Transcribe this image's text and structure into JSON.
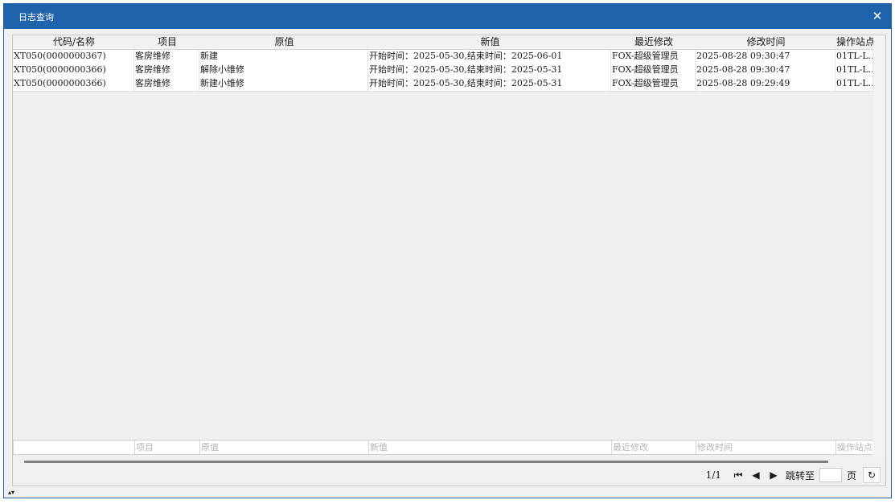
{
  "window": {
    "title": "日志查询",
    "close_glyph": "✕"
  },
  "table": {
    "columns": [
      "代码/名称",
      "项目",
      "原值",
      "新值",
      "最近修改",
      "修改时间",
      "操作站点"
    ],
    "rows": [
      [
        "XT050(0000000367)",
        "客房维修",
        "新建",
        "开始时间：2025-05-30,结束时间：2025-06-01",
        "FOX-超级管理员",
        "2025-08-28 09:30:47",
        "01TL-L..."
      ],
      [
        "XT050(0000000366)",
        "客房维修",
        "解除小维修",
        "开始时间：2025-05-30,结束时间：2025-05-31",
        "FOX-超级管理员",
        "2025-08-28 09:30:47",
        "01TL-L..."
      ],
      [
        "XT050(0000000366)",
        "客房维修",
        "新建小维修",
        "开始时间：2025-05-30,结束时间：2025-05-31",
        "FOX-超级管理员",
        "2025-08-28 09:29:49",
        "01TL-L..."
      ]
    ],
    "filter_placeholders": [
      "",
      "项目",
      "原值",
      "新值",
      "最近修改",
      "修改时间",
      "操作站点"
    ]
  },
  "pager": {
    "page_info": "1/1",
    "first_glyph": "⏮",
    "prev_glyph": "◀",
    "next_glyph": "▶",
    "jump_label": "跳转至",
    "jump_value": "",
    "page_unit": "页",
    "refresh_glyph": "↻"
  },
  "footer": {
    "toggle_glyph": "▴▾"
  },
  "colors": {
    "titlebar": "#1f63ad",
    "panel": "#f0f0f0"
  }
}
